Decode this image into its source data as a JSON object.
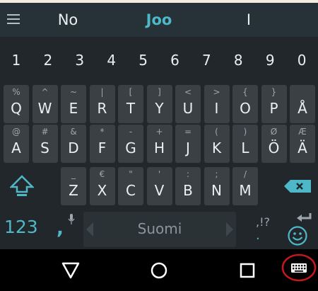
{
  "suggestions": {
    "left": "No",
    "center": "Joo",
    "right": "I"
  },
  "number_row": [
    "1",
    "2",
    "3",
    "4",
    "5",
    "6",
    "7",
    "8",
    "9",
    "0"
  ],
  "rows": [
    [
      {
        "main": "Q",
        "hint": "%"
      },
      {
        "main": "W",
        "hint": "^"
      },
      {
        "main": "E",
        "hint": "~"
      },
      {
        "main": "R",
        "hint": "|"
      },
      {
        "main": "T",
        "hint": "["
      },
      {
        "main": "Y",
        "hint": "]"
      },
      {
        "main": "U",
        "hint": "<"
      },
      {
        "main": "I",
        "hint": ">"
      },
      {
        "main": "O",
        "hint": "{"
      },
      {
        "main": "P",
        "hint": "}"
      },
      {
        "main": "Å",
        "hint": ""
      }
    ],
    [
      {
        "main": "A",
        "hint": "@"
      },
      {
        "main": "S",
        "hint": "#"
      },
      {
        "main": "D",
        "hint": "&"
      },
      {
        "main": "F",
        "hint": "*"
      },
      {
        "main": "G",
        "hint": "-"
      },
      {
        "main": "H",
        "hint": "+"
      },
      {
        "main": "J",
        "hint": "="
      },
      {
        "main": "K",
        "hint": "("
      },
      {
        "main": "L",
        "hint": ")"
      },
      {
        "main": "Ö",
        "hint": "Ø"
      },
      {
        "main": "Ä",
        "hint": "Æ"
      }
    ],
    [
      {
        "main": "Z",
        "hint": "_"
      },
      {
        "main": "X",
        "hint": "€"
      },
      {
        "main": "C",
        "hint": "\""
      },
      {
        "main": "V",
        "hint": "'"
      },
      {
        "main": "B",
        "hint": ":"
      },
      {
        "main": "N",
        "hint": ";"
      },
      {
        "main": "M",
        "hint": "/"
      }
    ]
  ],
  "bottom_row": {
    "symbols_label": "123",
    "comma_label": ",",
    "space_label": "Suomi",
    "punct_hint": ",!?",
    "period_label": "."
  },
  "colors": {
    "accent": "#4fb8c8",
    "key": "#3a4044",
    "background": "#21272a",
    "annotation": "#c0181e"
  },
  "icons": {
    "menu": "menu-icon",
    "shift": "shift-icon",
    "delete": "backspace-icon",
    "mic": "microphone-icon",
    "emoji": "emoji-icon",
    "enter": "enter-icon",
    "back": "nav-back-icon",
    "home": "nav-home-icon",
    "recents": "nav-recents-icon",
    "keyboard": "keyboard-switch-icon"
  }
}
